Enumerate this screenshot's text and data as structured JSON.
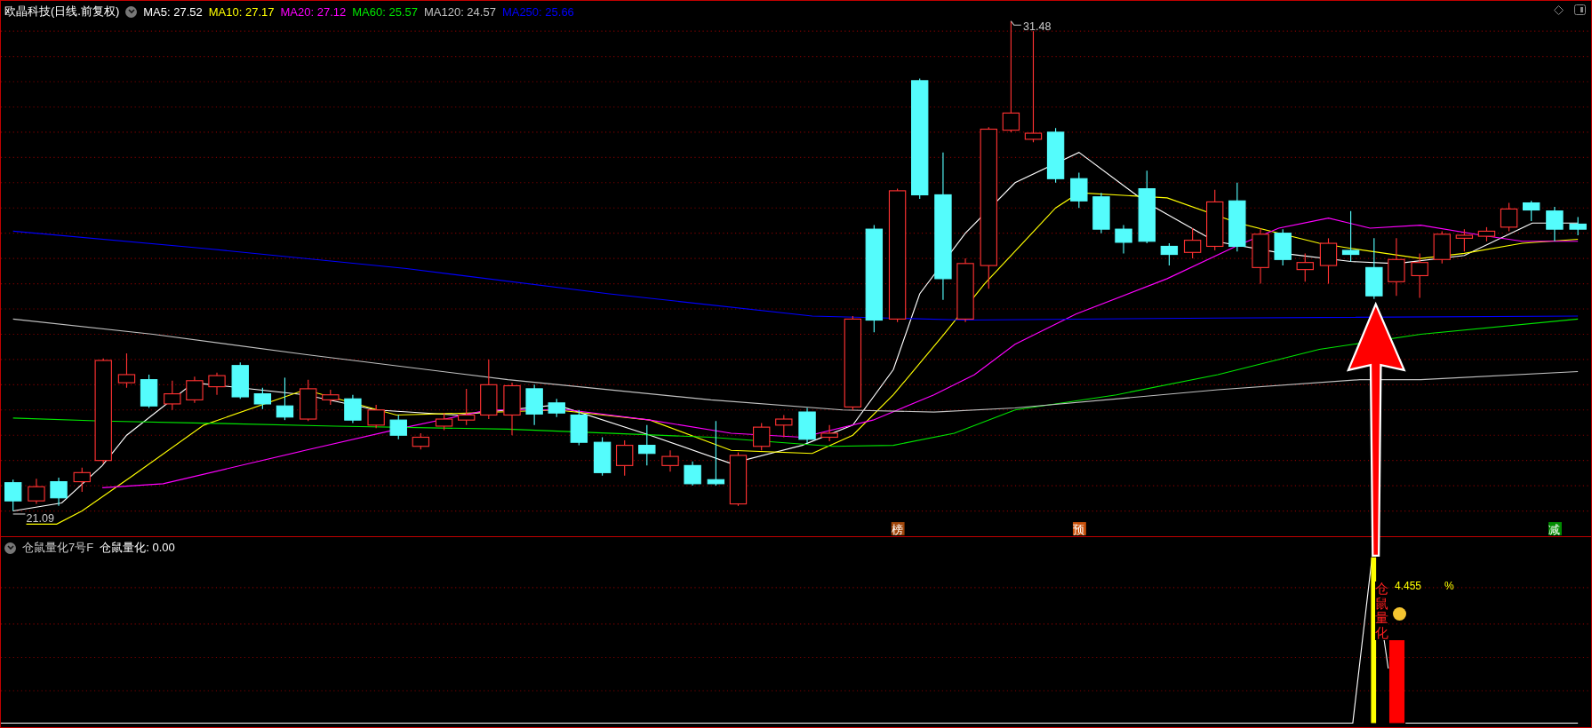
{
  "main_chart": {
    "title": "欧晶科技(日线.前复权)",
    "ma_legend": [
      {
        "label": "MA5: 27.52",
        "color": "#ffffff"
      },
      {
        "label": "MA10: 27.17",
        "color": "#ffff00"
      },
      {
        "label": "MA20: 27.12",
        "color": "#ff00ff"
      },
      {
        "label": "MA60: 25.57",
        "color": "#00e600"
      },
      {
        "label": "MA120: 24.57",
        "color": "#c0c0c0"
      },
      {
        "label": "MA250: 25.66",
        "color": "#0000ff"
      }
    ],
    "high_label": "31.48",
    "low_label": "21.09",
    "markers": [
      {
        "text": "榜",
        "color": "#a0460a"
      },
      {
        "text": "预",
        "color": "#c8500a"
      },
      {
        "text": "减",
        "color": "#008c00"
      }
    ]
  },
  "indicator": {
    "name": "仓鼠量化7号F",
    "value": "仓鼠量化: 0.00",
    "vertical_text": "仓鼠量化",
    "reading": "4.455",
    "unit": "%"
  }
}
